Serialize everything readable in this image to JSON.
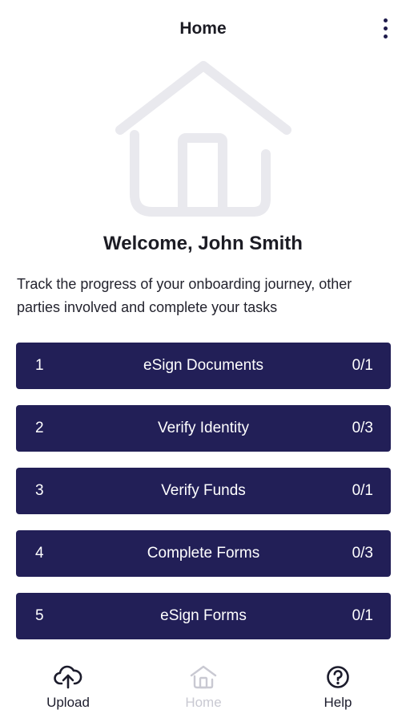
{
  "header": {
    "title": "Home",
    "more_icon": "more-vertical-icon"
  },
  "hero": {
    "icon": "house-icon"
  },
  "welcome": "Welcome, John Smith",
  "intro": "Track the progress of your onboarding journey, other parties involved and complete your tasks",
  "steps": [
    {
      "number": "1",
      "label": "eSign Documents",
      "progress": "0/1"
    },
    {
      "number": "2",
      "label": "Verify Identity",
      "progress": "0/3"
    },
    {
      "number": "3",
      "label": "Verify Funds",
      "progress": "0/1"
    },
    {
      "number": "4",
      "label": "Complete Forms",
      "progress": "0/3"
    },
    {
      "number": "5",
      "label": "eSign Forms",
      "progress": "0/1"
    }
  ],
  "bottom_nav": {
    "upload": {
      "label": "Upload",
      "icon": "cloud-upload-icon"
    },
    "home": {
      "label": "Home",
      "icon": "home-icon",
      "state": "disabled"
    },
    "help": {
      "label": "Help",
      "icon": "help-circle-icon"
    }
  },
  "colors": {
    "step_background": "#221f57",
    "step_text": "#ffffff",
    "hero_icon": "#e9e9ee",
    "nav_active": "#1c1c2c",
    "nav_inactive": "#c9c9d2"
  }
}
